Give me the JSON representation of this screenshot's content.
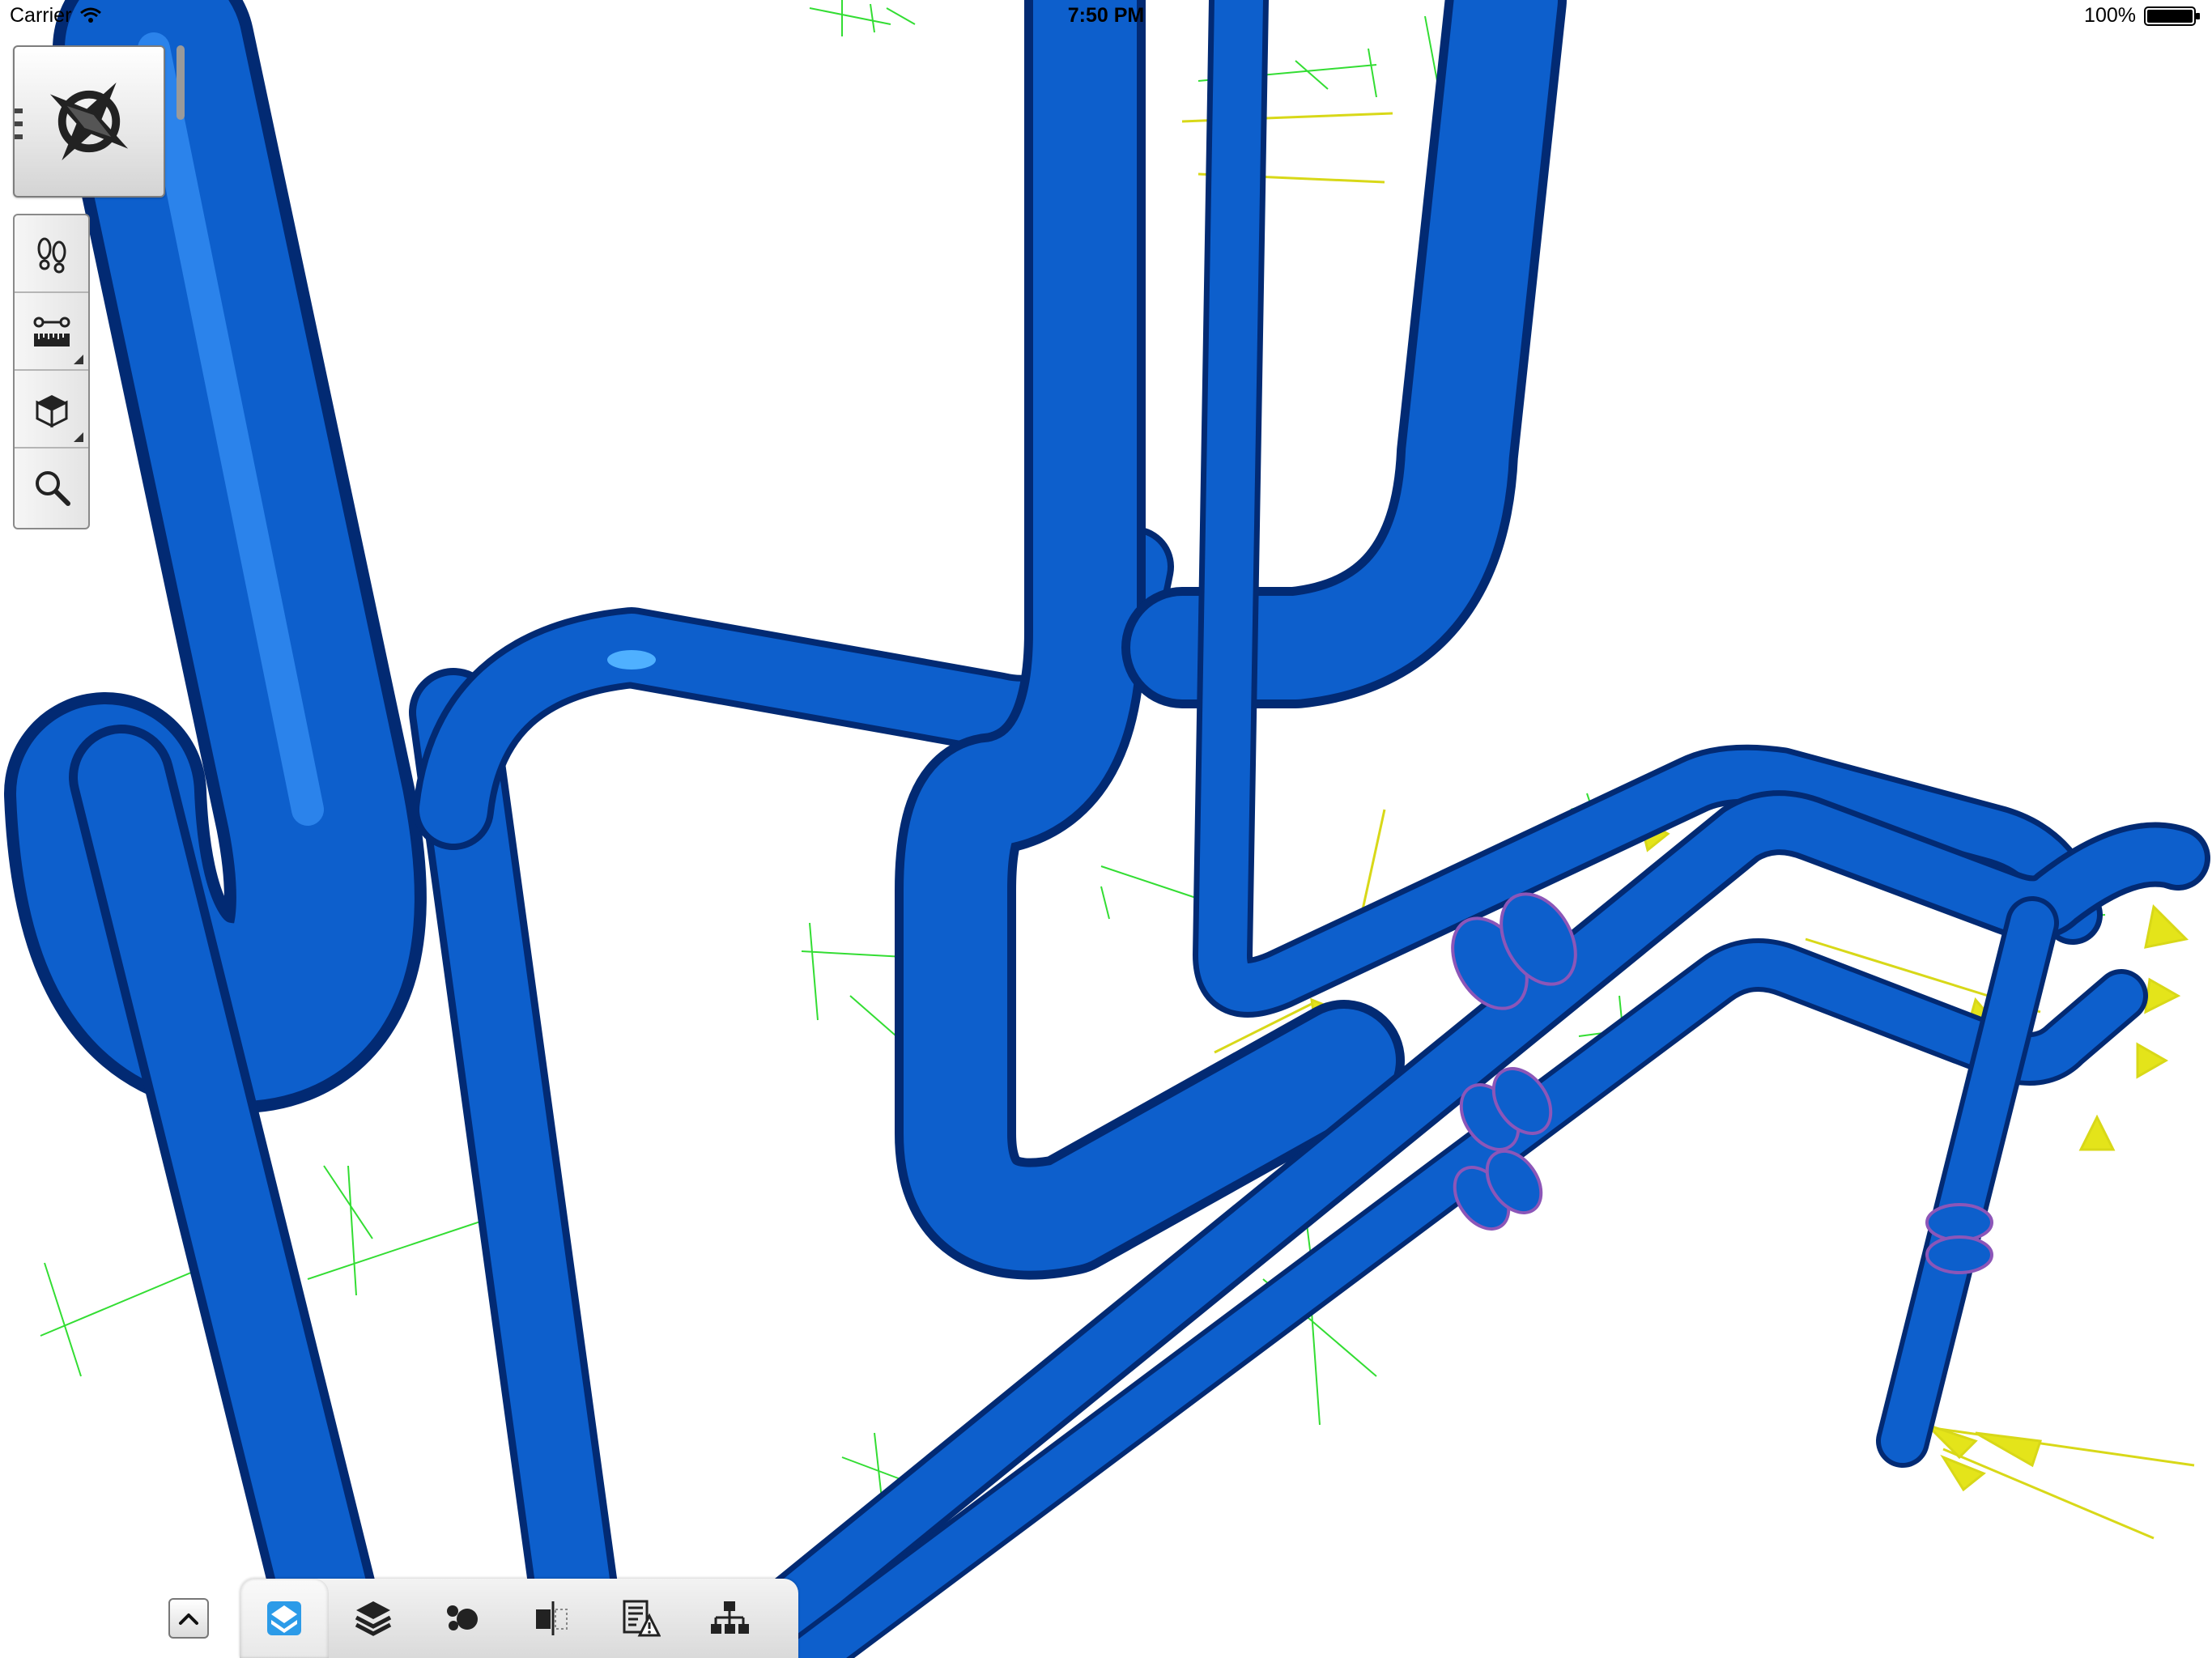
{
  "status_bar": {
    "carrier": "Carrier",
    "time": "7:50 PM",
    "battery": "100%"
  },
  "left_toolbar": {
    "main_button_icon": "compass-navigation-icon",
    "tools": [
      {
        "icon": "walk-footprints-icon",
        "has_submenu": false
      },
      {
        "icon": "measure-ruler-icon",
        "has_submenu": true
      },
      {
        "icon": "view-cube-icon",
        "has_submenu": true
      },
      {
        "icon": "zoom-magnifier-icon",
        "has_submenu": false
      }
    ]
  },
  "bottom_toolbar": {
    "expand_icon": "chevron-up-icon",
    "tabs": [
      {
        "icon": "model-view-icon",
        "active": true
      },
      {
        "icon": "layers-icon",
        "active": false
      },
      {
        "icon": "objects-icon",
        "active": false
      },
      {
        "icon": "section-plane-icon",
        "active": false
      },
      {
        "icon": "issues-report-icon",
        "active": false
      },
      {
        "icon": "hierarchy-tree-icon",
        "active": false
      }
    ]
  },
  "scene": {
    "pipe_color": "#0d5fcc",
    "pipe_highlight": "#3f9bff",
    "pipe_shadow": "#022a73",
    "flange_color": "#8c56b8",
    "support_color": "#33dd33",
    "arrow_color": "#e4e41a"
  }
}
